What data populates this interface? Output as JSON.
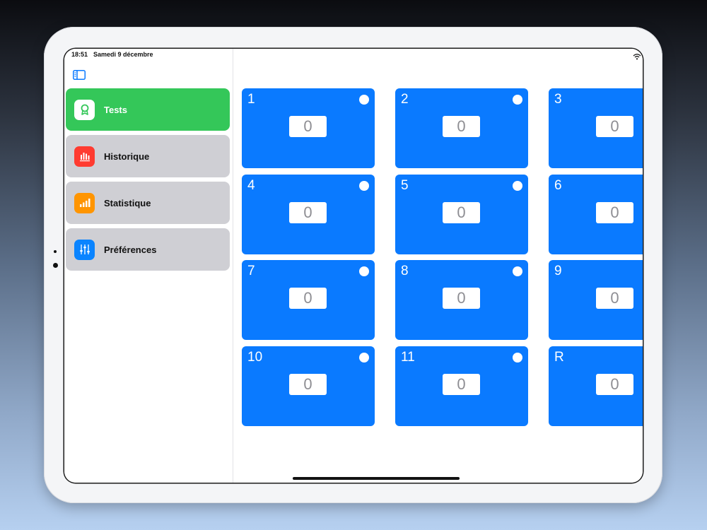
{
  "status_bar": {
    "time": "18:51",
    "date": "Samedi 9 décembre"
  },
  "sidebar": {
    "items": [
      {
        "label": "Tests",
        "icon": "award-ribbon-icon",
        "icon_bg": "#ffffff",
        "icon_color": "#34c759",
        "active": true
      },
      {
        "label": "Historique",
        "icon": "bar-chart-icon",
        "icon_bg": "#ff3b30",
        "icon_color": "#ffffff",
        "active": false
      },
      {
        "label": "Statistique",
        "icon": "signal-bars-icon",
        "icon_bg": "#ff9500",
        "icon_color": "#ffffff",
        "active": false
      },
      {
        "label": "Préférences",
        "icon": "sliders-icon",
        "icon_bg": "#0a84ff",
        "icon_color": "#ffffff",
        "active": false
      }
    ]
  },
  "grid": {
    "cards": [
      {
        "label": "1",
        "count": "0"
      },
      {
        "label": "2",
        "count": "0"
      },
      {
        "label": "3",
        "count": "0"
      },
      {
        "label": "4",
        "count": "0"
      },
      {
        "label": "5",
        "count": "0"
      },
      {
        "label": "6",
        "count": "0"
      },
      {
        "label": "7",
        "count": "0"
      },
      {
        "label": "8",
        "count": "0"
      },
      {
        "label": "9",
        "count": "0"
      },
      {
        "label": "10",
        "count": "0"
      },
      {
        "label": "11",
        "count": "0"
      },
      {
        "label": "R",
        "count": "0"
      }
    ]
  },
  "colors": {
    "accent_green": "#34c759",
    "card_blue": "#0a7aff",
    "nav_inactive": "#cfcfd4"
  }
}
